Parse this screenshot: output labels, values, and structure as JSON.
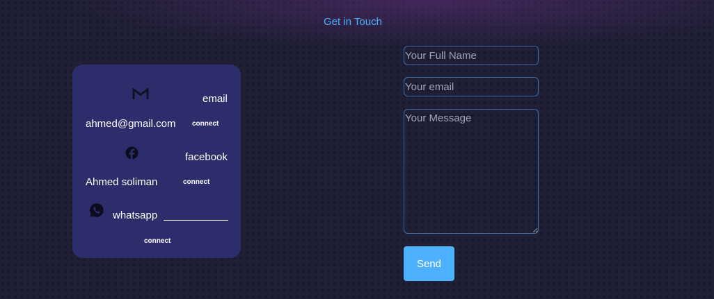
{
  "header": {
    "title": "Get in Touch"
  },
  "contact_card": {
    "email": {
      "icon": "gmail-icon",
      "label": "email",
      "value": "ahmed@gmail.com",
      "connect_label": "connect"
    },
    "facebook": {
      "icon": "facebook-icon",
      "label": "facebook",
      "value": "Ahmed soliman",
      "connect_label": "connect"
    },
    "whatsapp": {
      "icon": "whatsapp-icon",
      "label": "whatsapp",
      "connect_label": "connect"
    }
  },
  "form": {
    "name_placeholder": "Your Full Name",
    "email_placeholder": "Your email",
    "message_placeholder": "Your Message",
    "send_label": "Send"
  },
  "colors": {
    "background": "#1f1f35",
    "card": "#2e2d6b",
    "accent": "#4db1ff",
    "field_border": "#3e6eaa"
  }
}
